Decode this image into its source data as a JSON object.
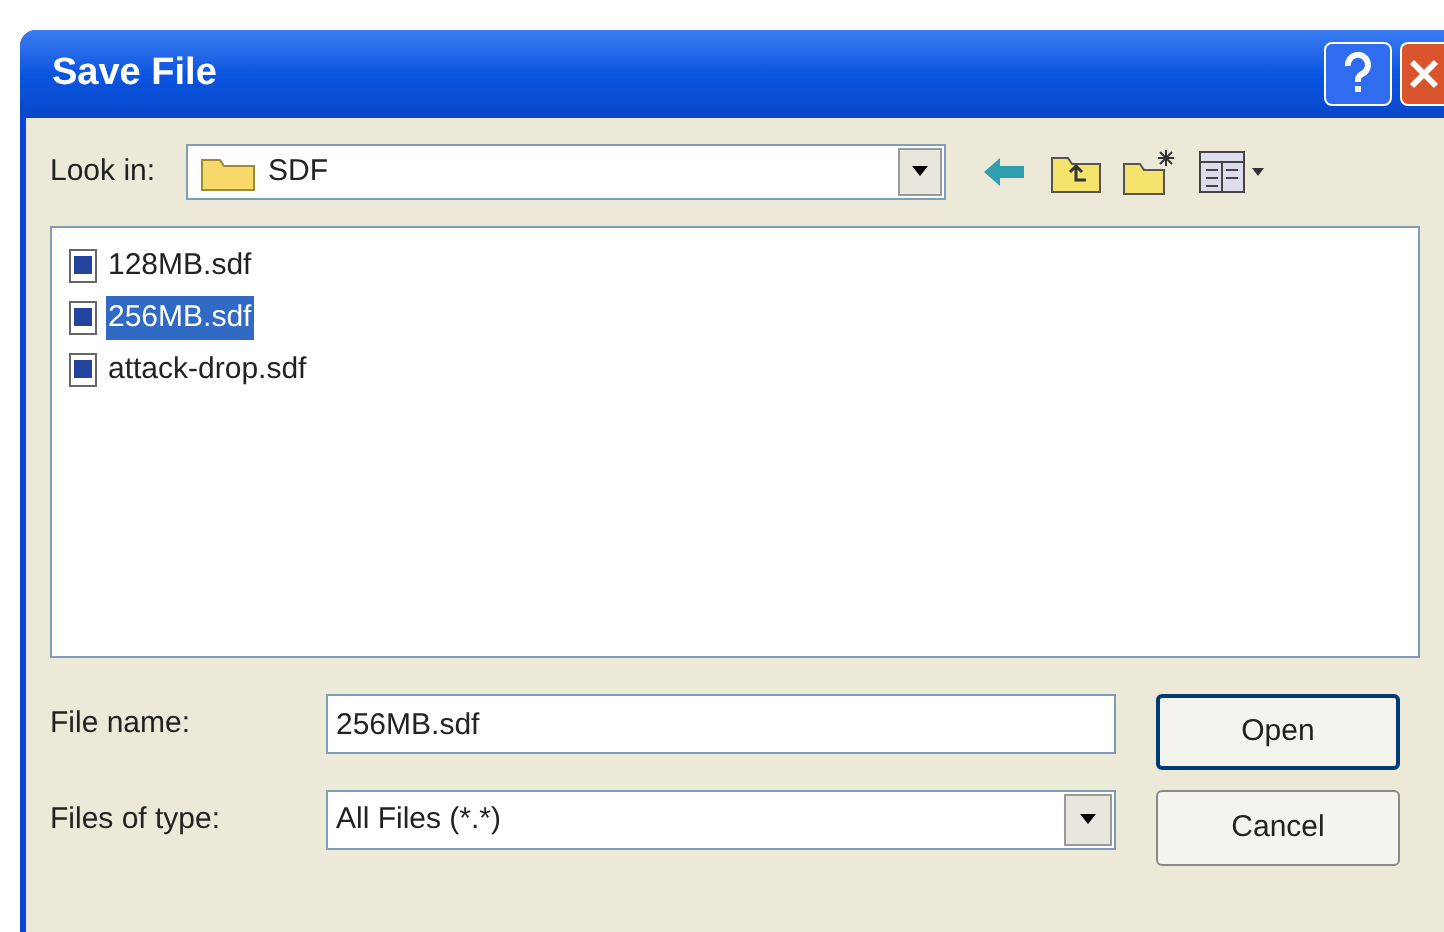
{
  "window": {
    "title": "Save File"
  },
  "look_in": {
    "label": "Look in:",
    "value": "SDF"
  },
  "files": [
    {
      "name": "128MB.sdf",
      "selected": false
    },
    {
      "name": "256MB.sdf",
      "selected": true
    },
    {
      "name": "attack-drop.sdf",
      "selected": false
    }
  ],
  "file_name": {
    "label": "File name:",
    "value": "256MB.sdf"
  },
  "file_type": {
    "label": "Files of type:",
    "value": "All Files (*.*)"
  },
  "buttons": [
    {
      "label": "Open"
    },
    {
      "label": "Cancel"
    }
  ]
}
